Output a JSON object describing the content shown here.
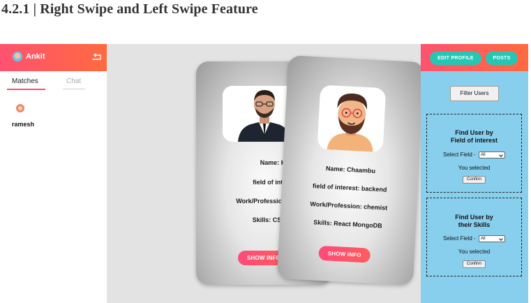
{
  "document": {
    "heading": "4.2.1 | Right Swipe and Left Swipe Feature"
  },
  "sidebar": {
    "user_name": "Ankit",
    "tabs": [
      {
        "label": "Matches"
      },
      {
        "label": "Chat"
      }
    ],
    "matches": [
      {
        "name": "ramesh"
      }
    ]
  },
  "cards": [
    {
      "name_line": "Name: Harsh",
      "interest_line": "field of interest: fr",
      "work_line": "Work/Profession:",
      "skills_line": "Skills: CSS Re",
      "button_label": "SHOW INFO"
    },
    {
      "name_line": "Name: Chaambu",
      "interest_line": "field of interest: backend",
      "work_line": "Work/Profession: chemist",
      "skills_line": "Skills: React MongoDB",
      "button_label": "SHOW INFO"
    }
  ],
  "right_panel": {
    "edit_profile_label": "EDIT PROFILE",
    "posts_label": "POSTS",
    "filter_button_label": "Filter Users",
    "field_box": {
      "title_line1": "Find User by",
      "title_line2": "Field of interest",
      "select_label": "Select Field -",
      "select_value": "All",
      "selected_text": "You selected",
      "confirm_label": "Confirm"
    },
    "skills_box": {
      "title_line1": "Find User by",
      "title_line2": "their Skills",
      "select_label": "Select Field -",
      "select_value": "All",
      "selected_text": "You selected",
      "confirm_label": "Confirm"
    }
  },
  "colors": {
    "header_gradient_start": "#ff5270",
    "header_gradient_end": "#ff6a3f",
    "right_panel_bg": "#88cfee",
    "pill_bg": "#26c6b4",
    "show_info_button": "#ff4a7a"
  }
}
